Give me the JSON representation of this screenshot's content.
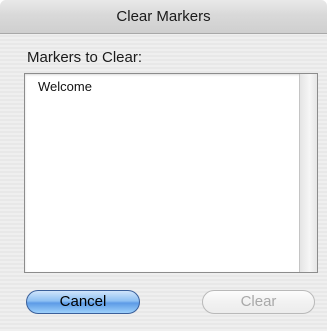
{
  "window": {
    "title": "Clear Markers"
  },
  "markers": {
    "label": "Markers to Clear:",
    "items": [
      "Welcome"
    ]
  },
  "buttons": {
    "cancel_label": "Cancel",
    "clear_label": "Clear",
    "clear_enabled": false
  },
  "colors": {
    "default_button": "#6fa8ea",
    "disabled_text": "#a9a9a9"
  }
}
